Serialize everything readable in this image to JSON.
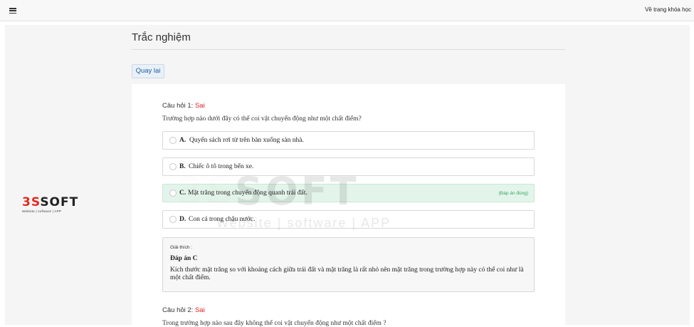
{
  "topbar": {
    "menu_icon": "hamburger-icon",
    "back_to_course_label": "Về trang khóa học"
  },
  "logo": {
    "brand_red": "3S",
    "brand_black": "SOFT",
    "tagline": "Website | software | APP"
  },
  "page": {
    "title": "Trắc nghiệm",
    "back_button_label": "Quay lại"
  },
  "questions": [
    {
      "header_prefix": "Câu hỏi 1:",
      "result": "Sai",
      "text": "Trường hợp nào dưới đây có thể coi vật chuyển động như một chất điểm?",
      "options": [
        {
          "letter": "A.",
          "text": "Quyển sách rơi từ trên bàn xuống sàn nhà.",
          "correct": false
        },
        {
          "letter": "B.",
          "text": "Chiếc ô tô trong bến xe.",
          "correct": false
        },
        {
          "letter": "C.",
          "text": "Mặt trăng trong chuyển động quanh trái đất.",
          "correct": true,
          "tag": "(Đáp án đúng)"
        },
        {
          "letter": "D.",
          "text": "Con cá trong chậu nước.",
          "correct": false
        }
      ],
      "explanation": {
        "label": "Giải thích :",
        "answer": "Đáp án C",
        "body": "Kích thước mặt trăng so với khoảng cách giữa trái đất và mặt trăng là rất nhỏ nên mặt trăng trong trường hợp này có thể coi như là một chất điểm."
      }
    },
    {
      "header_prefix": "Câu hỏi 2:",
      "result": "Sai",
      "text": "Trong trường hợp nào sau đây không thể coi vật chuyển động như một chất điểm ?"
    }
  ],
  "watermark": {
    "brand_red": "3S",
    "brand_black": "SOFT",
    "tagline": "Website | software | APP"
  },
  "colors": {
    "wrong": "#e01e1e",
    "correct_bg": "#e3f5ea",
    "correct_text": "#3aa35c",
    "button_text": "#1f5f9f"
  }
}
